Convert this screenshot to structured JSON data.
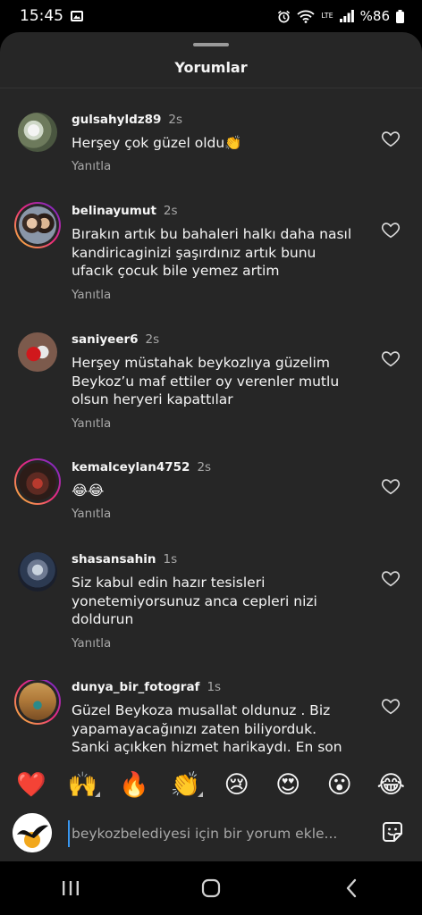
{
  "status": {
    "time": "15:45",
    "battery": "%86",
    "network": "LTE"
  },
  "sheet": {
    "title": "Yorumlar"
  },
  "comments": [
    {
      "username": "gulsahyldz89",
      "time": "2s",
      "text": "Herşey çok güzel oldu👏",
      "reply": "Yanıtla"
    },
    {
      "username": "belinayumut",
      "time": "2s",
      "text": "Bırakın artık bu bahaleri halkı daha nasıl kandiricaginizi şaşırdınız artık bunu ufacık çocuk bile yemez artim",
      "reply": "Yanıtla"
    },
    {
      "username": "saniyeer6",
      "time": "2s",
      "text": "Herşey müstahak beykozlıya güzelim Beykoz’u maf ettiler oy verenler mutlu olsun heryeri kapattılar",
      "reply": "Yanıtla"
    },
    {
      "username": "kemalceylan4752",
      "time": "2s",
      "text": "😂😂",
      "reply": "Yanıtla"
    },
    {
      "username": "shasansahin",
      "time": "1s",
      "text": "Siz kabul edin hazır tesisleri yonetemiyorsunuz anca cepleri nizi doldurun",
      "reply": "Yanıtla"
    },
    {
      "username": "dunya_bir_fotograf",
      "time": "1s",
      "text": "Güzel Beykoza musallat oldunuz . Biz yapamayacağınızı zaten biliyorduk. Sanki açıkken hizmet harikaydı. En son"
    }
  ],
  "reactions": [
    "❤️",
    "🙌",
    "🔥",
    "👏",
    "😢",
    "😍",
    "😮",
    "😂"
  ],
  "input": {
    "placeholder": "beykozbelediyesi için bir yorum ekle..."
  }
}
